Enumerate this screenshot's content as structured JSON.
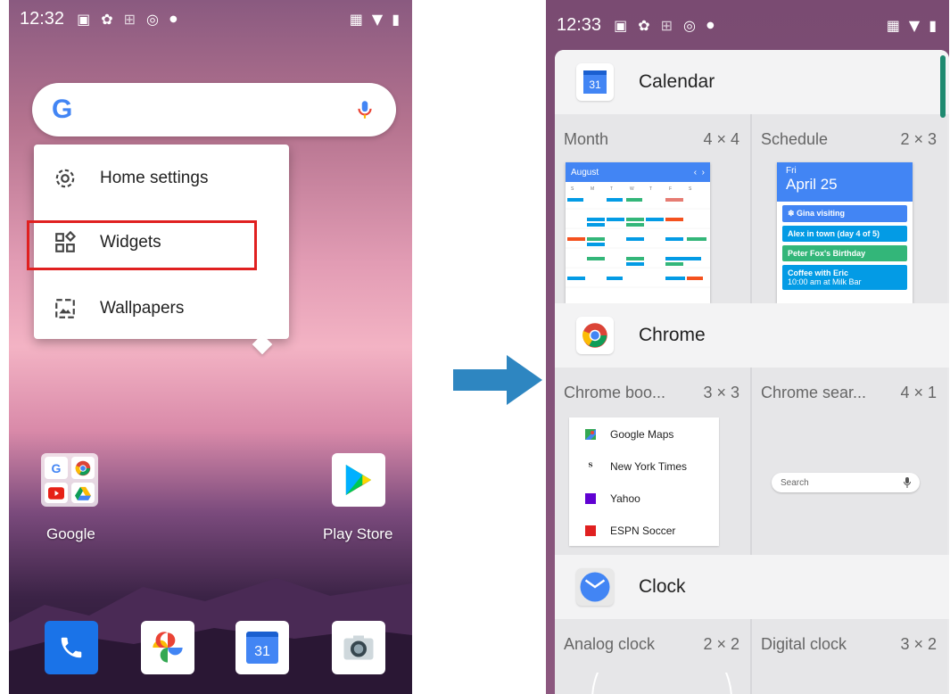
{
  "left_screen": {
    "status": {
      "time": "12:32"
    },
    "menu": {
      "items": [
        {
          "label": "Home settings",
          "icon": "gear-icon"
        },
        {
          "label": "Widgets",
          "icon": "widgets-icon"
        },
        {
          "label": "Wallpapers",
          "icon": "wallpaper-icon"
        }
      ],
      "highlighted_item": "Widgets",
      "highlight_color": "#e02020"
    },
    "apps": {
      "google_folder_label": "Google",
      "play_store_label": "Play Store"
    },
    "dock": [
      {
        "name": "phone-icon"
      },
      {
        "name": "photos-icon"
      },
      {
        "name": "calendar-icon",
        "text": "31"
      },
      {
        "name": "camera-icon"
      }
    ]
  },
  "right_screen": {
    "status": {
      "time": "12:33"
    },
    "apps": [
      {
        "name": "Calendar",
        "icon_text": "31",
        "widgets": [
          {
            "name": "Month",
            "size": "4 × 4"
          },
          {
            "name": "Schedule",
            "size": "2 × 3"
          }
        ]
      },
      {
        "name": "Chrome",
        "widgets": [
          {
            "name": "Chrome boo...",
            "size": "3 × 3"
          },
          {
            "name": "Chrome sear...",
            "size": "4 × 1"
          }
        ]
      },
      {
        "name": "Clock",
        "widgets": [
          {
            "name": "Analog clock",
            "size": "2 × 2"
          },
          {
            "name": "Digital clock",
            "size": "3 × 2"
          }
        ]
      }
    ],
    "calendar_month_preview": {
      "month": "August"
    },
    "schedule_preview": {
      "day": "Fri",
      "date": "April 25",
      "events": [
        {
          "label": "Gina visiting",
          "color": "#4285f4"
        },
        {
          "label": "Alex in town (day 4 of 5)",
          "color": "#039be5"
        },
        {
          "label": "Peter Fox's Birthday",
          "color": "#33b679"
        },
        {
          "label": "Coffee with Eric",
          "sub": "10:00 am at Milk Bar",
          "color": "#039be5"
        }
      ]
    },
    "bookmarks_preview": [
      {
        "label": "Google Maps"
      },
      {
        "label": "New York Times"
      },
      {
        "label": "Yahoo"
      },
      {
        "label": "ESPN Soccer"
      }
    ],
    "chrome_search_placeholder": "Search"
  },
  "accent_colors": {
    "arrow": "#2e86c1",
    "google_blue": "#4285f4"
  }
}
